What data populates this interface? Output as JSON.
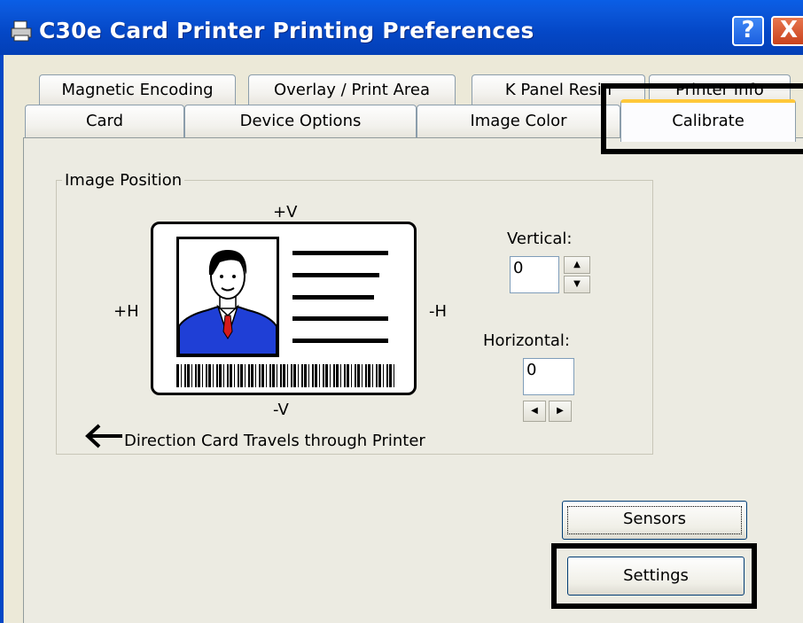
{
  "window": {
    "title": "C30e Card Printer Printing Preferences",
    "help_label": "?",
    "close_label": "X"
  },
  "tabs": {
    "back_row": [
      "Magnetic Encoding",
      "Overlay / Print Area",
      "K Panel Resin",
      "Printer Info"
    ],
    "front_row": [
      "Card",
      "Device Options",
      "Image Color",
      "Calibrate"
    ],
    "active": "Calibrate"
  },
  "image_position": {
    "legend": "Image Position",
    "top_label": "+V",
    "bottom_label": "-V",
    "left_label": "+H",
    "right_label": "-H",
    "direction_text": "Direction Card Travels through Printer",
    "direction_arrow": "←"
  },
  "vertical": {
    "label": "Vertical:",
    "value": "0"
  },
  "horizontal": {
    "label": "Horizontal:",
    "value": "0"
  },
  "buttons": {
    "sensors": "Sensors",
    "settings": "Settings"
  },
  "colors": {
    "titlebar": "#0447c6",
    "active_tab_accent": "#ffc83a",
    "suit": "#1f3fd6"
  }
}
